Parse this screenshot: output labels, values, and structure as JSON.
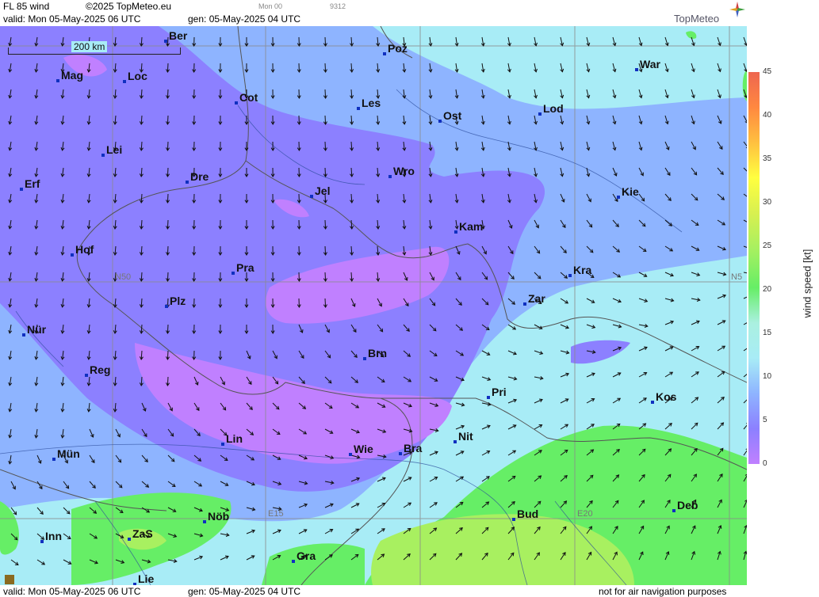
{
  "header": {
    "product": "FL 85 wind",
    "copyright": "©2025 TopMeteo.eu",
    "small_time": "Mon 00",
    "small_code": "9312",
    "valid": "valid:  Mon  05-May-2025  06 UTC",
    "gen": "gen: 05-May-2025 04 UTC",
    "brand": "TopMeteo"
  },
  "footer": {
    "valid": "valid:  Mon  05-May-2025  06 UTC",
    "gen": "gen: 05-May-2025 04 UTC",
    "disclaimer": "not for air navigation purposes"
  },
  "map": {
    "scale_label": "200 km",
    "grid_labels": [
      "N50",
      "N5",
      "E15",
      "E20"
    ],
    "cities": [
      {
        "name": "Ber"
      },
      {
        "name": "Poz"
      },
      {
        "name": "War"
      },
      {
        "name": "Mag"
      },
      {
        "name": "Loc"
      },
      {
        "name": "Cot"
      },
      {
        "name": "Les"
      },
      {
        "name": "Lod"
      },
      {
        "name": "Ost"
      },
      {
        "name": "Lei"
      },
      {
        "name": "Wro"
      },
      {
        "name": "Erf"
      },
      {
        "name": "Dre"
      },
      {
        "name": "Jel"
      },
      {
        "name": "Kie"
      },
      {
        "name": "Kam"
      },
      {
        "name": "Hof"
      },
      {
        "name": "Pra"
      },
      {
        "name": "Kra"
      },
      {
        "name": "Zar"
      },
      {
        "name": "Plz"
      },
      {
        "name": "Nür"
      },
      {
        "name": "Brn"
      },
      {
        "name": "Reg"
      },
      {
        "name": "Pri"
      },
      {
        "name": "Kos"
      },
      {
        "name": "Lin"
      },
      {
        "name": "Nit"
      },
      {
        "name": "Bra"
      },
      {
        "name": "Wie"
      },
      {
        "name": "Mün"
      },
      {
        "name": "Deb"
      },
      {
        "name": "Nöb"
      },
      {
        "name": "Bud"
      },
      {
        "name": "ZaS"
      },
      {
        "name": "Inn"
      },
      {
        "name": "Gra"
      },
      {
        "name": "Lie"
      }
    ]
  },
  "legend": {
    "title": "wind speed [kt]",
    "ticks": [
      "45",
      "40",
      "35",
      "30",
      "25",
      "20",
      "15",
      "10",
      "5",
      "0"
    ],
    "colors": [
      "#c080ff",
      "#8c80ff",
      "#8eb4ff",
      "#a8ecf6",
      "#aaf0e0",
      "#66ee66",
      "#a8f060",
      "#d8f050",
      "#ffff40",
      "#ffc040",
      "#ff8840",
      "#ee6650"
    ]
  }
}
